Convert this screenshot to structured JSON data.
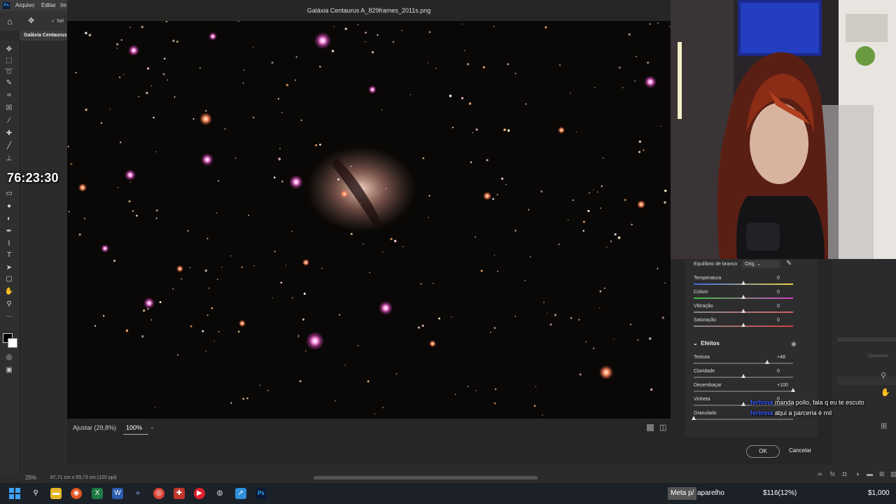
{
  "app": {
    "menu": [
      "Arquivo",
      "Editar",
      "Im"
    ],
    "options_sel": "Sel",
    "doc_tab": "Galáxia Centaurus"
  },
  "overlay": {
    "timer": "76:23:30"
  },
  "dialog": {
    "title": "Galáxia Centaurus A_829frames_2011s.png",
    "fit_label": "Ajustar (29,8%)",
    "zoom": "100%",
    "ok": "OK",
    "cancel": "Cancelar"
  },
  "panel": {
    "white_balance_label": "Equilíbrio de branco",
    "white_balance_value": "Orig.",
    "sliders": [
      {
        "label": "Temperatura",
        "value": "0",
        "level": 0.5
      },
      {
        "label": "Colorir",
        "value": "0",
        "level": 0.5
      },
      {
        "label": "Vibração",
        "value": "0",
        "level": 0.5
      },
      {
        "label": "Saturação",
        "value": "0",
        "level": 0.5
      }
    ],
    "effects_title": "Efeitos",
    "effects": [
      {
        "label": "Textura",
        "value": "+48",
        "level": 0.74
      },
      {
        "label": "Claridade",
        "value": "0",
        "level": 0.5
      },
      {
        "label": "Desembaçar",
        "value": "+100",
        "level": 1.0
      },
      {
        "label": "Vinheta",
        "value": "0",
        "level": 0.5
      },
      {
        "label": "Granulado",
        "value": "0",
        "level": 0.0
      }
    ]
  },
  "chat": [
    {
      "user": "ferlinna",
      "message": "manda pollo, fala q eu te escuto"
    },
    {
      "user": "ferlinna",
      "message": "aqui a parceria é mil"
    }
  ],
  "status": {
    "zoom": "25%",
    "doc_size": "87,71 cm x 59,73 cm (120 ppi)"
  },
  "ticker": {
    "highlight": "Meta p/",
    "text1": "aparelho",
    "text2": "$116(12%)",
    "text3": "$1,000"
  },
  "colors": {
    "accent_blue": "#31a8ff",
    "chat_user": "#3a5dff",
    "star_pink": "#ff6ad5"
  }
}
